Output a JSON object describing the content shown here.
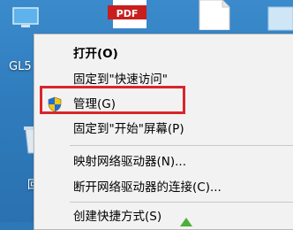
{
  "desktop": {
    "computer_label": "GL5",
    "recycle_label": "回",
    "pdf_badge": "PDF"
  },
  "context_menu": {
    "items": [
      {
        "label": "打开(O)",
        "bold": true
      },
      {
        "label": "固定到\"快速访问\""
      },
      {
        "label": "管理(G)",
        "icon": "uac-shield-icon",
        "highlighted": true
      },
      {
        "label": "固定到\"开始\"屏幕(P)"
      },
      {
        "label": "映射网络驱动器(N)..."
      },
      {
        "label": "断开网络驱动器的连接(C)..."
      },
      {
        "label": "创建快捷方式(S)"
      }
    ]
  },
  "colors": {
    "highlight_border": "#d8262c",
    "menu_background": "#f2f2f2",
    "desktop_background": "#2f7cbd"
  }
}
